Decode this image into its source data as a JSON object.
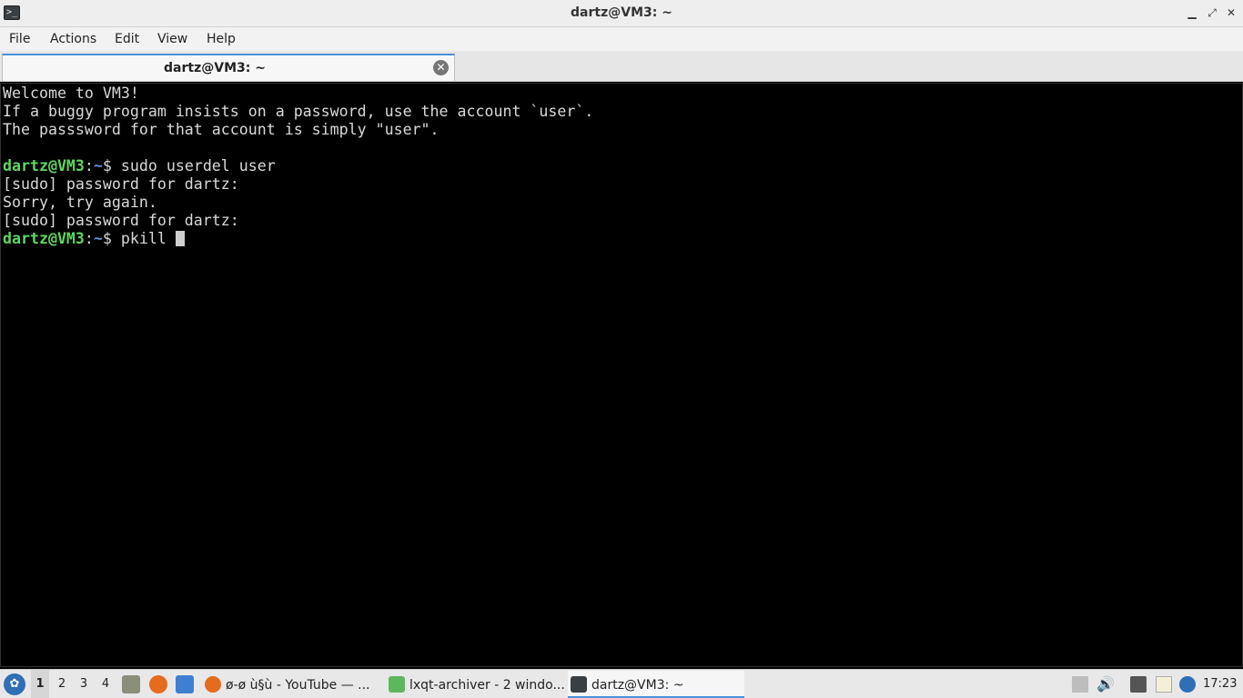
{
  "window": {
    "title": "dartz@VM3: ~",
    "app_icon": ">_",
    "controls": {
      "minimize": "▁",
      "maximize": "⤢",
      "close": "✕"
    }
  },
  "menu": [
    "File",
    "Actions",
    "Edit",
    "View",
    "Help"
  ],
  "tab": {
    "label": "dartz@VM3: ~",
    "close_icon": "✕"
  },
  "terminal": {
    "lines": [
      "Welcome to VM3!",
      "If a buggy program insists on a password, use the account `user`.",
      "The passsword for that account is simply \"user\".",
      ""
    ],
    "prompt": {
      "user": "dartz@VM3",
      "colon": ":",
      "path": "~",
      "symbol": "$ "
    },
    "command1": "sudo userdel user",
    "output": [
      "[sudo] password for dartz:",
      "Sorry, try again.",
      "[sudo] password for dartz:"
    ],
    "command2": "pkill "
  },
  "taskbar": {
    "desktops": [
      "1",
      "2",
      "3",
      "4"
    ],
    "tasks": [
      {
        "label": "ø-ø ù§ù - YouTube — ...",
        "icon": "firefox-icon"
      },
      {
        "label": "lxqt-archiver - 2 windo...",
        "icon": "archiver-icon"
      },
      {
        "label": "dartz@VM3: ~",
        "icon": "terminal-icon"
      }
    ],
    "clock": "17:23"
  },
  "colors": {
    "prompt_user": "#5fd75f",
    "prompt_path": "#5c8fe6",
    "terminal_bg": "#000000",
    "terminal_fg": "#d9d9d9",
    "accent": "#4a90d9"
  }
}
